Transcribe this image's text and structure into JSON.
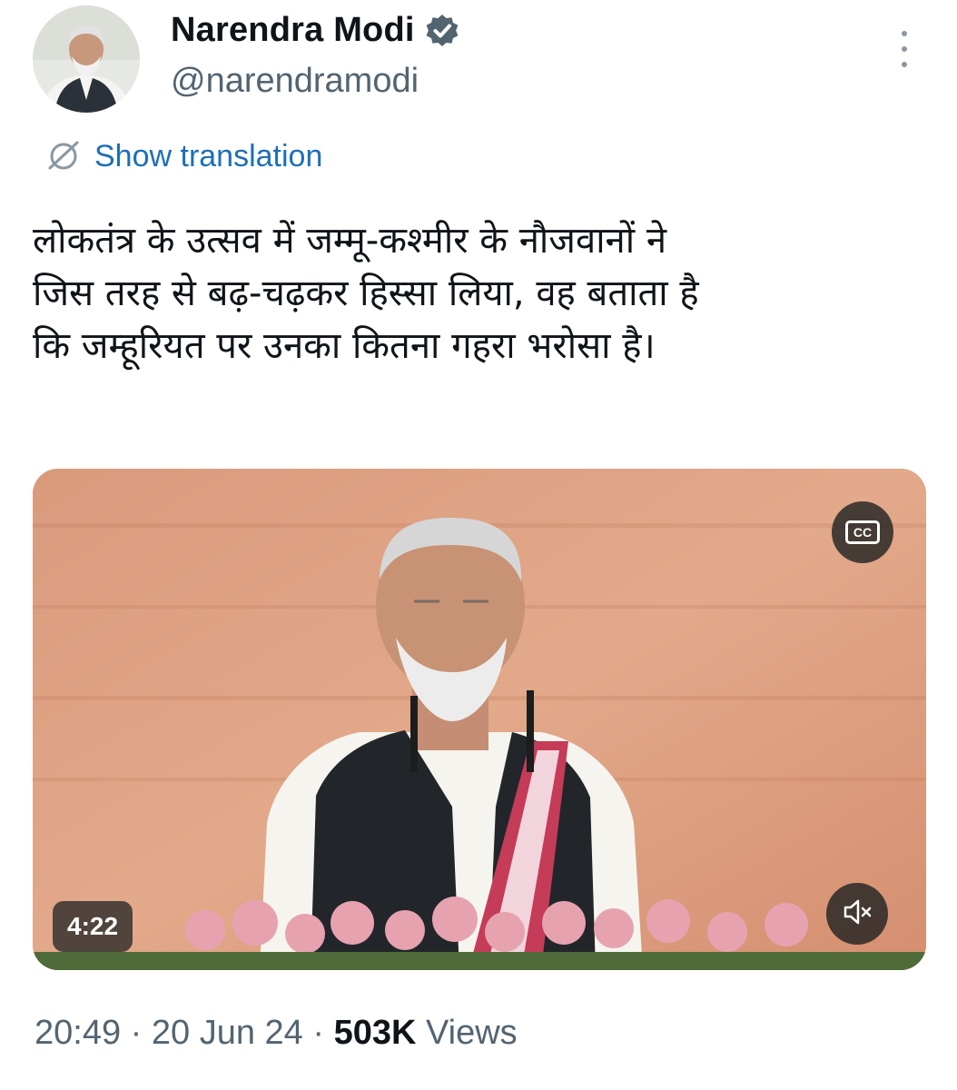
{
  "author": {
    "display_name": "Narendra Modi",
    "handle": "@narendramodi",
    "verified_icon": "verified-badge-icon",
    "verified_color": "#536471"
  },
  "translate": {
    "label": "Show translation",
    "icon": "translate-globe-icon",
    "color": "#1d6fb8"
  },
  "tweet": {
    "lines": [
      "लोकतंत्र के उत्सव में जम्मू-कश्मीर के नौजवानों ने",
      "जिस तरह से बढ़-चढ़कर हिस्सा लिया, वह बताता है",
      "कि जम्हूरियत पर उनका कितना गहरा भरोसा है।"
    ]
  },
  "video": {
    "duration": "4:22",
    "captions_icon": "closed-captions-icon",
    "captions_label": "CC",
    "mute_icon": "speaker-muted-icon"
  },
  "meta": {
    "time": "20:49",
    "separator": " · ",
    "date": "20 Jun 24",
    "views_count": "503K",
    "views_label": " Views"
  }
}
